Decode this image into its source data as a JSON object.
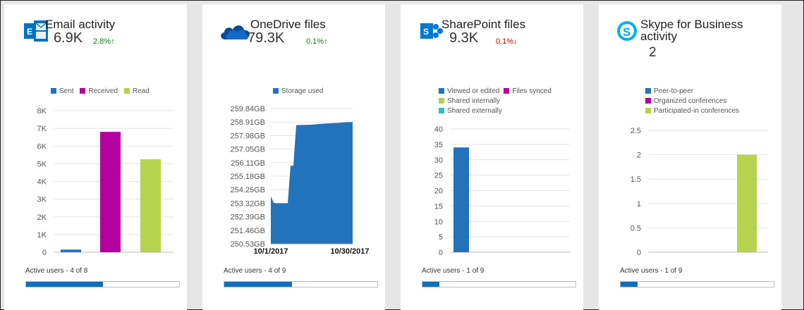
{
  "colors": {
    "accent_blue": "#106ebe",
    "series_blue": "#2173bc",
    "magenta": "#b4009e",
    "lime": "#b7d24c",
    "teal": "#2bbec2",
    "up_green": "#107c10",
    "down_red": "#c00000"
  },
  "cards": [
    {
      "title": "Email activity",
      "icon": "exchange-email-icon",
      "value": "6.9K",
      "delta": "2.8%",
      "delta_dir": "up",
      "legend": [
        "Sent",
        "Received",
        "Read"
      ],
      "active_users": "Active users - 4 of 8",
      "active_fraction": 0.5
    },
    {
      "title": "OneDrive files",
      "icon": "onedrive-cloud-icon",
      "value": "79.3K",
      "delta": "0.1%",
      "delta_dir": "up",
      "legend": [
        "Storage used"
      ],
      "active_users": "Active users - 4 of 9",
      "active_fraction": 0.444
    },
    {
      "title": "SharePoint files",
      "icon": "sharepoint-icon",
      "value": "9.3K",
      "delta": "0.1%",
      "delta_dir": "down",
      "legend": [
        "Viewed or edited",
        "Files synced",
        "Shared internally",
        "Shared externally"
      ],
      "active_users": "Active users - 1 of 9",
      "active_fraction": 0.111
    },
    {
      "title_line1": "Skype for Business",
      "title_line2": "activity",
      "icon": "skype-icon",
      "value": "2",
      "legend": [
        "Peer-to-peer",
        "Organized conferences",
        "Participated-in conferences"
      ],
      "active_users": "Active users - 1 of 9",
      "active_fraction": 0.111
    }
  ],
  "chart_data": [
    {
      "type": "bar",
      "categories": [
        "Sent",
        "Received",
        "Read"
      ],
      "series": [
        {
          "name": "Sent",
          "values": [
            150,
            0,
            0
          ]
        },
        {
          "name": "Received",
          "values": [
            0,
            6800,
            0
          ]
        },
        {
          "name": "Read",
          "values": [
            0,
            0,
            5250
          ]
        }
      ],
      "values": [
        150,
        6800,
        5250
      ],
      "ylim": [
        0,
        8000
      ],
      "yticks": [
        "0",
        "1K",
        "2K",
        "3K",
        "4K",
        "5K",
        "6K",
        "7K",
        "8K"
      ],
      "legend_position": "top",
      "grid": true
    },
    {
      "type": "area",
      "series": [
        {
          "name": "Storage used"
        }
      ],
      "x_labels": [
        "10/1/2017",
        "10/30/2017"
      ],
      "x": [
        "10/1/2017",
        "10/2/2017",
        "10/3/2017",
        "10/6/2017",
        "10/7/2017",
        "10/8/2017",
        "10/9/2017",
        "10/10/2017",
        "10/15/2017",
        "10/20/2017",
        "10/25/2017",
        "10/28/2017",
        "10/30/2017"
      ],
      "values_gb": [
        253.8,
        253.35,
        253.32,
        253.32,
        253.32,
        255.9,
        255.9,
        258.7,
        258.72,
        258.8,
        258.85,
        258.9,
        258.9
      ],
      "ylim_gb": [
        250.53,
        259.84
      ],
      "yticks": [
        "250.53GB",
        "251.46GB",
        "252.39GB",
        "253.32GB",
        "254.25GB",
        "255.18GB",
        "256.11GB",
        "257.05GB",
        "257.98GB",
        "258.91GB",
        "259.84GB"
      ],
      "legend_position": "top",
      "grid": true
    },
    {
      "type": "bar",
      "categories": [
        "Viewed or edited",
        "Files synced",
        "Shared internally",
        "Shared externally"
      ],
      "series": [
        {
          "name": "Viewed or edited",
          "values": [
            34
          ]
        },
        {
          "name": "Files synced",
          "values": [
            0
          ]
        },
        {
          "name": "Shared internally",
          "values": [
            0
          ]
        },
        {
          "name": "Shared externally",
          "values": [
            0
          ]
        }
      ],
      "values": [
        34,
        0,
        0,
        0
      ],
      "ylim": [
        0,
        40
      ],
      "yticks": [
        "0",
        "5",
        "10",
        "15",
        "20",
        "25",
        "30",
        "35",
        "40"
      ],
      "legend_position": "top",
      "grid": true
    },
    {
      "type": "bar",
      "categories": [
        "Peer-to-peer",
        "Organized conferences",
        "Participated-in conferences"
      ],
      "series": [
        {
          "name": "Peer-to-peer",
          "values": [
            0,
            0,
            0
          ]
        },
        {
          "name": "Organized conferences",
          "values": [
            0,
            0,
            0
          ]
        },
        {
          "name": "Participated-in conferences",
          "values": [
            0,
            0,
            2
          ]
        }
      ],
      "values": [
        0,
        0,
        2
      ],
      "ylim": [
        0,
        2.5
      ],
      "yticks": [
        "0",
        "0.5",
        "1",
        "1.5",
        "2",
        "2.5"
      ],
      "legend_position": "top",
      "grid": true
    }
  ]
}
